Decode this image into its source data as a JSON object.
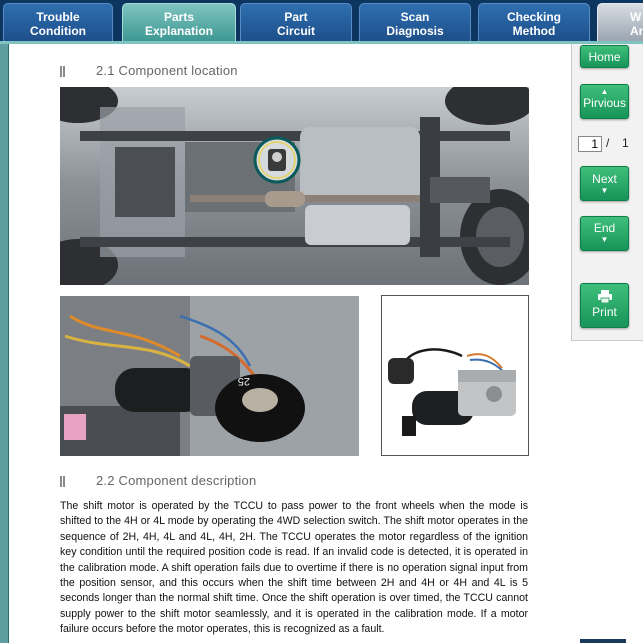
{
  "tabs": [
    {
      "line1": "Trouble",
      "line2": "Condition",
      "active": false
    },
    {
      "line1": "Parts",
      "line2": "Explanation",
      "active": true
    },
    {
      "line1": "Part",
      "line2": "Circuit",
      "active": false
    },
    {
      "line1": "Scan",
      "line2": "Diagnosis",
      "active": false
    },
    {
      "line1": "Checking",
      "line2": "Method",
      "active": false
    },
    {
      "line1": "W",
      "line2": "An",
      "active": false
    }
  ],
  "sections": {
    "location": {
      "title": "2.1 Component location"
    },
    "description": {
      "title": "2.2 Component description",
      "body": "The shift motor is operated by the TCCU to pass power to the front wheels when the mode is shifted to the 4H or 4L mode by operating the 4WD selection switch. The shift motor operates in the sequence of 2H, 4H, 4L and 4L, 4H, 2H. The TCCU operates the motor regardless of the ignition key condition until the required position code is read. If an invalid code is detected, it is operated in the calibration mode. A shift operation fails due to overtime if there is no operation signal input from the position sensor, and this occurs when the shift time between 2H and 4H or 4H and 4L is 5 seconds longer than the normal shift time. Once the shift operation is over timed, the TCCU cannot supply power to the shift motor seamlessly, and it is operated in the calibration mode. If a motor failure occurs before the motor operates, this is recognized as a fault."
    }
  },
  "images": {
    "detail_stamp": "25"
  },
  "nav": {
    "home": "Home",
    "previous": "Pirvious",
    "page_current": "1",
    "page_sep": "/",
    "page_total": "1",
    "next": "Next",
    "end": "End",
    "print": "Print"
  },
  "colors": {
    "tab_bar": "#0c3560",
    "tab_active": "#3e9893",
    "nav_button": "#17955a",
    "highlight_ring": "#0a5a5a"
  },
  "icons": [
    "arrow-up-icon",
    "arrow-down-icon",
    "double-arrow-down-icon",
    "printer-icon",
    "section-marker-icon"
  ]
}
